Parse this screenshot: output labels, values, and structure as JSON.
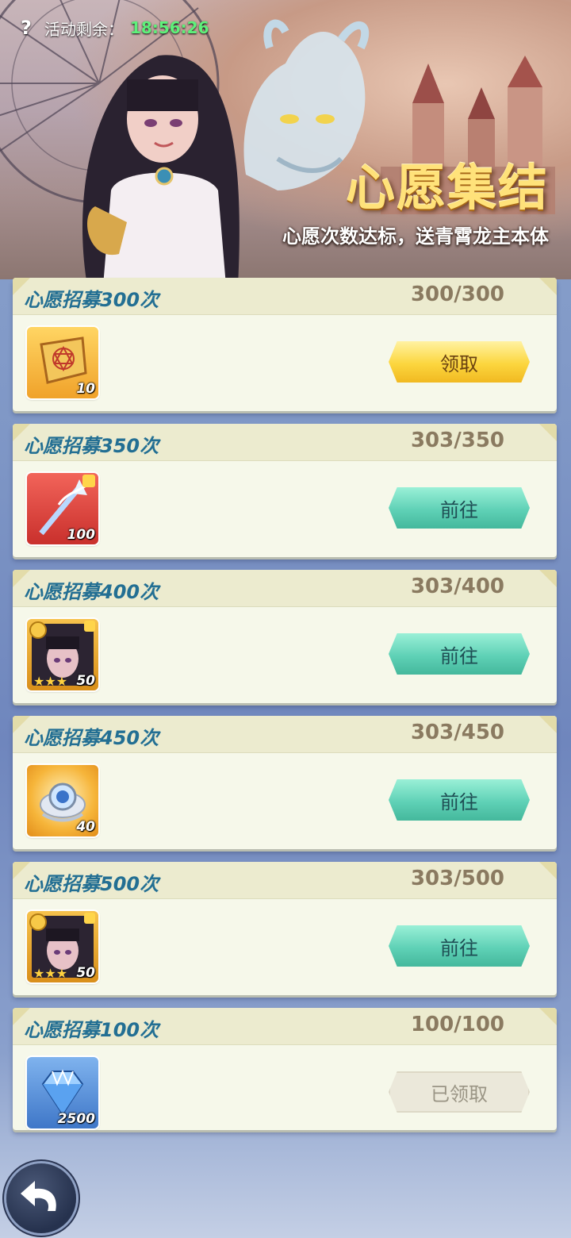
{
  "header": {
    "help_icon": "question-mark-icon",
    "timer_label": "活动剩余：",
    "timer_value": "18:56:26",
    "title": "心愿集结",
    "subtitle": "心愿次数达标，送青霄龙主本体"
  },
  "colors": {
    "title": "#ffe27a",
    "timer_value": "#5ef07a",
    "card_title": "#236f93",
    "claim_button": "#fcd63e",
    "go_button": "#5fd1b6"
  },
  "tasks": [
    {
      "title": "心愿招募300次",
      "progress": "300/300",
      "item": "summon-scroll-icon",
      "count": "10",
      "button": "领取",
      "state": "claim"
    },
    {
      "title": "心愿招募350次",
      "progress": "303/350",
      "item": "ice-spear-fragment-icon",
      "count": "100",
      "button": "前往",
      "state": "go"
    },
    {
      "title": "心愿招募400次",
      "progress": "303/400",
      "item": "hero-fragment-icon",
      "count": "50",
      "button": "前往",
      "state": "go"
    },
    {
      "title": "心愿招募450次",
      "progress": "303/450",
      "item": "spirit-orb-icon",
      "count": "40",
      "button": "前往",
      "state": "go"
    },
    {
      "title": "心愿招募500次",
      "progress": "303/500",
      "item": "hero-fragment-icon",
      "count": "50",
      "button": "前往",
      "state": "go"
    },
    {
      "title": "心愿招募100次",
      "progress": "100/100",
      "item": "diamond-icon",
      "count": "2500",
      "button": "已领取",
      "state": "done"
    }
  ],
  "footer": {
    "back_icon": "back-arrow-icon"
  }
}
